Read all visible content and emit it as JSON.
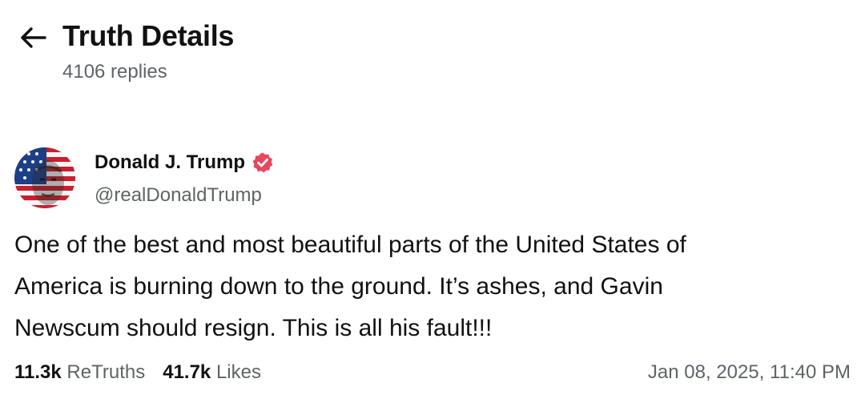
{
  "header": {
    "title": "Truth Details",
    "reply_count": "4106 replies"
  },
  "post": {
    "author_name": "Donald J. Trump",
    "author_handle": "@realDonaldTrump",
    "verified_color": "#e8475f",
    "avatar_icon": "flag-portrait-avatar",
    "body_line_1": "One of the best and most beautiful parts of the United States of",
    "body_line_2": "America is burning down to the ground. It’s ashes, and Gavin",
    "body_line_3": "Newscum should resign. This is all his fault!!!",
    "retruths_count": "11.3k",
    "retruths_label": "ReTruths",
    "likes_count": "41.7k",
    "likes_label": "Likes",
    "timestamp": "Jan 08, 2025, 11:40 PM"
  }
}
